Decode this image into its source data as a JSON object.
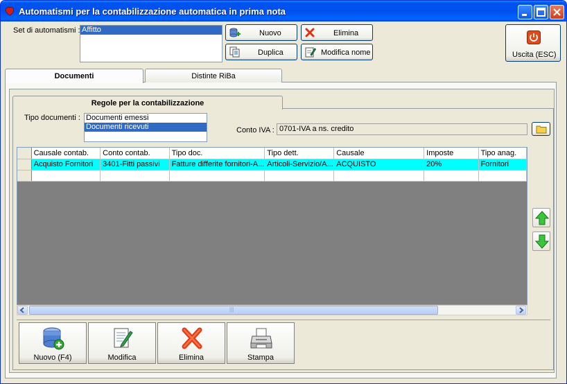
{
  "window": {
    "title": "Automatismi per la contabilizzazione automatica in prima nota"
  },
  "top": {
    "set_label": "Set di automatismi :",
    "set_items": [
      "Affitto"
    ],
    "buttons": {
      "nuovo": "Nuovo",
      "elimina": "Elimina",
      "duplica": "Duplica",
      "modifica_nome": "Modifica nome",
      "uscita": "Uscita (ESC)"
    }
  },
  "tabs": [
    "Documenti",
    "Distinte RiBa"
  ],
  "inner_tab": "Regole per la contabilizzazione",
  "tipo_documenti": {
    "label": "Tipo documenti :",
    "items": [
      "Documenti emessi",
      "Documenti ricevuti"
    ],
    "selected": "Documenti ricevuti"
  },
  "conto_iva": {
    "label": "Conto IVA :",
    "value": "0701-IVA a ns. credito"
  },
  "grid": {
    "headers": [
      "Causale contab.",
      "Conto contab.",
      "Tipo doc.",
      "Tipo dett.",
      "Causale",
      "Imposte",
      "Tipo anag."
    ],
    "rows": [
      [
        "Acquisto Fornitori",
        "3401-Fitti passivi",
        "Fatture differite fornitori-A...",
        "Articoli-Servizio/A...",
        "ACQUISTO",
        "20%",
        "Fornitori"
      ]
    ]
  },
  "bottom_buttons": {
    "nuovo": "Nuovo (F4)",
    "modifica": "Modifica",
    "elimina": "Elimina",
    "stampa": "Stampa"
  },
  "scrollbar": {
    "thumb_label": "|||"
  }
}
